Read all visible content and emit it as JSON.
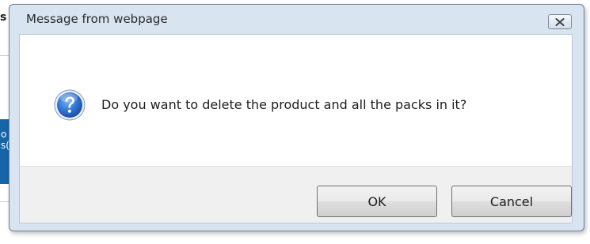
{
  "background": {
    "fragment_top": "s",
    "fragment_blue_lines": [
      "o",
      "s("
    ]
  },
  "dialog": {
    "title": "Message from webpage",
    "close_icon": "close-icon",
    "icon": "question-icon",
    "message": "Do you want to delete the product and all the packs in it?",
    "buttons": {
      "ok_label": "OK",
      "cancel_label": "Cancel"
    }
  },
  "colors": {
    "frame": "#d9e4f1",
    "button_area": "#f0f0f0",
    "icon_blue": "#1f5fb8",
    "background_blue": "#1565a8"
  }
}
